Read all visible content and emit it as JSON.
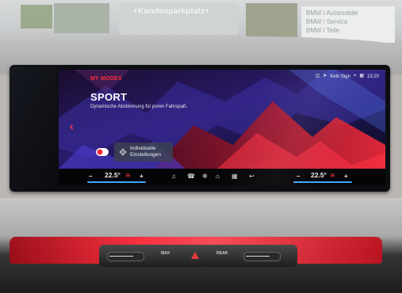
{
  "scene": {
    "shop_sign": "+Kundenparkplatz+",
    "bmw_lines": [
      "BMW  i Automobile",
      "BMW  i Service",
      "BMW  i Teile"
    ]
  },
  "status": {
    "signal_text": "Kein Sign",
    "time": "13:20"
  },
  "mode": {
    "eyebrow": "MY MODES",
    "title": "SPORT",
    "description": "Dynamische Abstimmung für puren Fahrspaß.",
    "settings_label_line1": "Individuelle",
    "settings_label_line2": "Einstellungen"
  },
  "climate": {
    "left_temp": "22.5°",
    "right_temp": "22.5°",
    "minus": "–",
    "plus": "+"
  },
  "console": {
    "left_button": "MAX",
    "right_button": "REAR"
  },
  "colors": {
    "accent": "#ff2b3a",
    "temp_line": "#3fa6ff"
  },
  "icons": [
    "back-chevron-icon",
    "music-icon",
    "phone-icon",
    "fan-icon",
    "home-icon",
    "apps-icon",
    "call-icon",
    "gear-icon",
    "location-icon",
    "wifi-icon",
    "seat-heat-icon"
  ]
}
